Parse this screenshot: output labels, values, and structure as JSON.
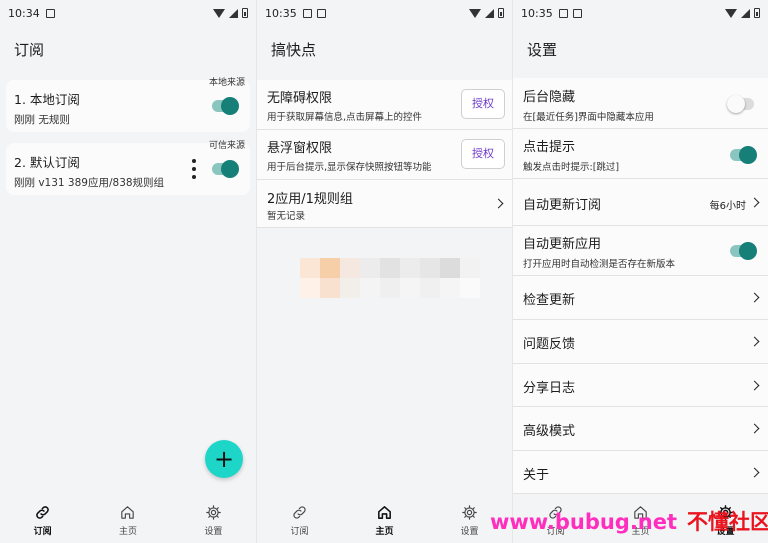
{
  "screens": {
    "subscriptions": {
      "status_time": "10:34",
      "title": "订阅",
      "cards": [
        {
          "title": "1. 本地订阅",
          "meta": "刚刚  无规则",
          "source": "本地来源",
          "enabled": true
        },
        {
          "title": "2. 默认订阅",
          "meta": "刚刚  v131  389应用/838规则组",
          "source": "可信来源",
          "enabled": true
        }
      ],
      "fab_label": "+"
    },
    "home": {
      "status_time": "10:35",
      "title": "搞快点",
      "rows": [
        {
          "title": "无障碍权限",
          "sub": "用于获取屏幕信息,点击屏幕上的控件",
          "button": "授权"
        },
        {
          "title": "悬浮窗权限",
          "sub": "用于后台提示,显示保存快照按钮等功能",
          "button": "授权"
        },
        {
          "title": "2应用/1规则组",
          "sub": "暂无记录"
        }
      ]
    },
    "settings": {
      "status_time": "10:35",
      "title": "设置",
      "rows": [
        {
          "title": "后台隐藏",
          "sub": "在[最近任务]界面中隐藏本应用",
          "toggle": false
        },
        {
          "title": "点击提示",
          "sub": "触发点击时提示:[跳过]",
          "toggle": true
        },
        {
          "title": "自动更新订阅",
          "value": "每6小时"
        },
        {
          "title": "自动更新应用",
          "sub": "打开应用时自动检测是否存在新版本",
          "toggle": true
        },
        {
          "title": "检查更新"
        },
        {
          "title": "问题反馈"
        },
        {
          "title": "分享日志"
        },
        {
          "title": "高级模式"
        },
        {
          "title": "关于"
        }
      ]
    }
  },
  "nav": {
    "subscriptions_label": "订阅",
    "home_label": "主页",
    "settings_label": "设置"
  },
  "nav_icons": [
    "link-icon",
    "home-icon",
    "gear-icon"
  ],
  "watermark": {
    "site": "www.bubug.net",
    "brand": "不懂社区"
  },
  "colors": {
    "accent": "#167f78",
    "fab": "#1ed6c8",
    "authorize_text": "#6e3ac9"
  }
}
